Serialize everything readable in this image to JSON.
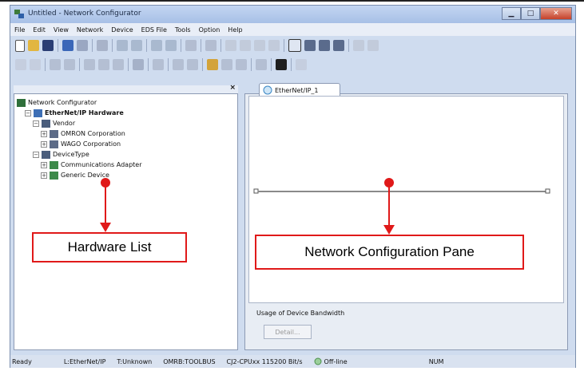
{
  "window": {
    "title": "Untitled - Network Configurator"
  },
  "menu": [
    "File",
    "Edit",
    "View",
    "Network",
    "Device",
    "EDS File",
    "Tools",
    "Option",
    "Help"
  ],
  "left_pane": {
    "tree": [
      {
        "label": "Network Configurator",
        "level": 0,
        "expander": "",
        "bold": false
      },
      {
        "label": "EtherNet/IP Hardware",
        "level": 1,
        "expander": "−",
        "bold": true
      },
      {
        "label": "Vendor",
        "level": 2,
        "expander": "−",
        "bold": false
      },
      {
        "label": "OMRON Corporation",
        "level": 3,
        "expander": "+",
        "bold": false
      },
      {
        "label": "WAGO Corporation",
        "level": 3,
        "expander": "+",
        "bold": false
      },
      {
        "label": "DeviceType",
        "level": 2,
        "expander": "−",
        "bold": false
      },
      {
        "label": "Communications Adapter",
        "level": 3,
        "expander": "+",
        "bold": false
      },
      {
        "label": "Generic Device",
        "level": 3,
        "expander": "+",
        "bold": false
      }
    ],
    "close_glyph": "×"
  },
  "right_pane": {
    "tab_label": "EtherNet/IP_1",
    "bandwidth_label": "Usage of Device Bandwidth",
    "detail_button": "Detail..."
  },
  "status_bar": [
    "Ready",
    "L:EtherNet/IP",
    "T:Unknown",
    "OMRB:TOOLBUS",
    "CJ2-CPUxx  115200 Bit/s",
    "Off-line",
    "NUM"
  ],
  "callouts": {
    "left": "Hardware List",
    "right": "Network Configuration Pane"
  },
  "colors": {
    "accent_red": "#e01919",
    "title_blue": "#a7c0e6"
  }
}
